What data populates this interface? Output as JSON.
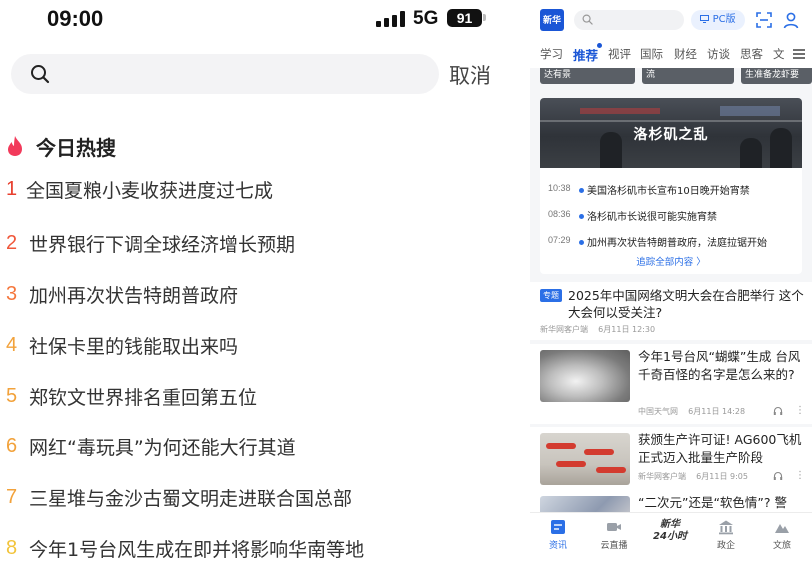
{
  "left": {
    "status": {
      "time": "09:00",
      "network": "5G",
      "battery": "91"
    },
    "search": {
      "placeholder": "",
      "cancel_label": "取消"
    },
    "hot": {
      "title": "今日热搜",
      "items": [
        {
          "rank": "1",
          "text": "全国夏粮小麦收获进度过七成",
          "color": "#e8402f"
        },
        {
          "rank": "2",
          "text": "世界银行下调全球经济增长预期",
          "color": "#f0573a"
        },
        {
          "rank": "3",
          "text": "加州再次状告特朗普政府",
          "color": "#f5773d"
        },
        {
          "rank": "4",
          "text": "社保卡里的钱能取出来吗",
          "color": "#f2a23b"
        },
        {
          "rank": "5",
          "text": "郑钦文世界排名重回第五位",
          "color": "#f2a23b"
        },
        {
          "rank": "6",
          "text": "网红“毒玩具”为何还能大行其道",
          "color": "#f2a23b"
        },
        {
          "rank": "7",
          "text": "三星堆与金沙古蜀文明走进联合国总部",
          "color": "#f2a23b"
        },
        {
          "rank": "8",
          "text": "今年1号台风生成在即并将影响华南等地",
          "color": "#f2c43b"
        }
      ]
    }
  },
  "right": {
    "logo": "新华",
    "pc_label": "PC版",
    "tabs": [
      "学习",
      "推荐",
      "视评",
      "国际",
      "财经",
      "访谈",
      "思客",
      "文"
    ],
    "active_tab": "推荐",
    "thumbs": [
      "达有景",
      "流",
      "生准备龙虾要"
    ],
    "la_card": {
      "title": "洛杉矶之乱",
      "timeline": [
        {
          "time": "10:38",
          "text": "美国洛杉矶市长宣布10日晚开始宵禁"
        },
        {
          "time": "08:36",
          "text": "洛杉矶市长说很可能实施宵禁"
        },
        {
          "time": "07:29",
          "text": "加州再次状告特朗普政府，法庭拉锯开始"
        }
      ],
      "follow_label": "追踪全部内容 〉"
    },
    "topic": {
      "badge": "专题",
      "title": "2025年中国网络文明大会在合肥举行 这个大会何以受关注?",
      "source": "新华网客户端",
      "time": "6月11日 12:30"
    },
    "news": [
      {
        "title": "今年1号台风“蝴蝶”生成 台风千奇百怪的名字是怎么来的?",
        "source": "中国天气网",
        "time": "6月11日 14:28"
      },
      {
        "title": "获颁生产许可证! AG600飞机正式迈入批量生产阶段",
        "source": "新华网客户端",
        "time": "6月11日 9:05"
      },
      {
        "title": "“二次元”还是“软色情”? 警",
        "source": "",
        "time": ""
      }
    ],
    "tabbar": [
      {
        "label": "资讯"
      },
      {
        "label": "云直播"
      },
      {
        "label": "",
        "brand_top": "新华",
        "brand_bottom": "24小时"
      },
      {
        "label": "政企"
      },
      {
        "label": "文旅"
      }
    ],
    "accent": "#2b6fe6"
  }
}
